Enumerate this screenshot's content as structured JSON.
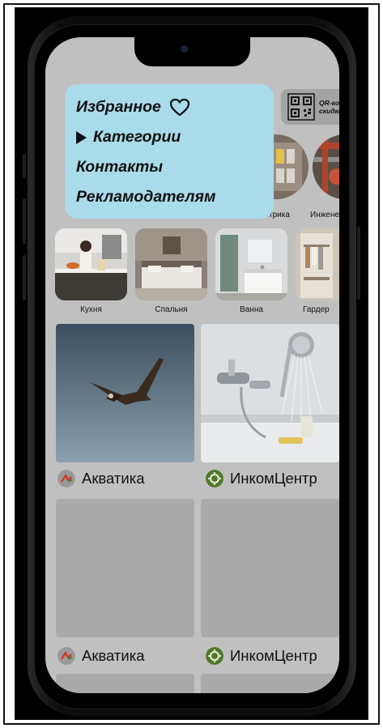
{
  "menu": {
    "favorites": "Избранное",
    "categories": "Категории",
    "contacts": "Контакты",
    "advertisers": "Рекламодателям"
  },
  "qr": {
    "line1": "QR-код",
    "line2": "скидки"
  },
  "categories": [
    {
      "label": "…трика"
    },
    {
      "label": "Инженерк"
    }
  ],
  "rooms": [
    {
      "label": "Кухня"
    },
    {
      "label": "Спальня"
    },
    {
      "label": "Ванна"
    },
    {
      "label": "Гардер"
    }
  ],
  "products": [
    {
      "brand": "Акватика"
    },
    {
      "brand": "ИнкомЦентр"
    },
    {
      "brand": "Акватика"
    },
    {
      "brand": "ИнкомЦентр"
    }
  ],
  "colors": {
    "menu_bg": "#a9dbea",
    "screen_bg": "#c0c0c0",
    "placeholder": "#aaaaaa",
    "aquatica_accent": "#d23a2a",
    "incom_green": "#4f7a2a"
  }
}
